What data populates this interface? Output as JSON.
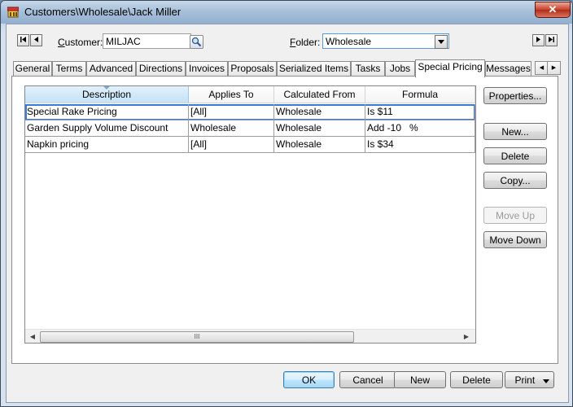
{
  "window": {
    "title": "Customers\\Wholesale\\Jack Miller",
    "close_glyph": "✕"
  },
  "header": {
    "customer_label_accel": "C",
    "customer_label_rest": "ustomer:",
    "customer_value": "MILJAC",
    "folder_label_accel": "F",
    "folder_label_rest": "older:",
    "folder_value": "Wholesale"
  },
  "tabs": [
    "General",
    "Terms",
    "Advanced",
    "Directions",
    "Invoices",
    "Proposals",
    "Serialized Items",
    "Tasks",
    "Jobs",
    "Special Pricing",
    "Messages"
  ],
  "active_tab": "Special Pricing",
  "grid": {
    "columns": [
      "Description",
      "Applies To",
      "Calculated From",
      "Formula"
    ],
    "rows": [
      [
        "Special Rake Pricing",
        "[All]",
        "Wholesale",
        "Is $11"
      ],
      [
        "Garden Supply Volume Discount",
        "Wholesale",
        "Wholesale",
        "Add -10   %"
      ],
      [
        "Napkin pricing",
        "[All]",
        "Wholesale",
        "Is $34"
      ]
    ],
    "scroll_thumb_glyph": "III"
  },
  "side_buttons": {
    "properties": "Properties...",
    "new": "New...",
    "delete": "Delete",
    "copy": "Copy...",
    "move_up": "Move Up",
    "move_down": "Move Down"
  },
  "footer_buttons": {
    "ok": "OK",
    "cancel": "Cancel",
    "new": "New",
    "delete": "Delete",
    "print": "Print"
  },
  "colors": {
    "selection": "#3a7bd5",
    "sorted_header": "#c4e2f7"
  }
}
